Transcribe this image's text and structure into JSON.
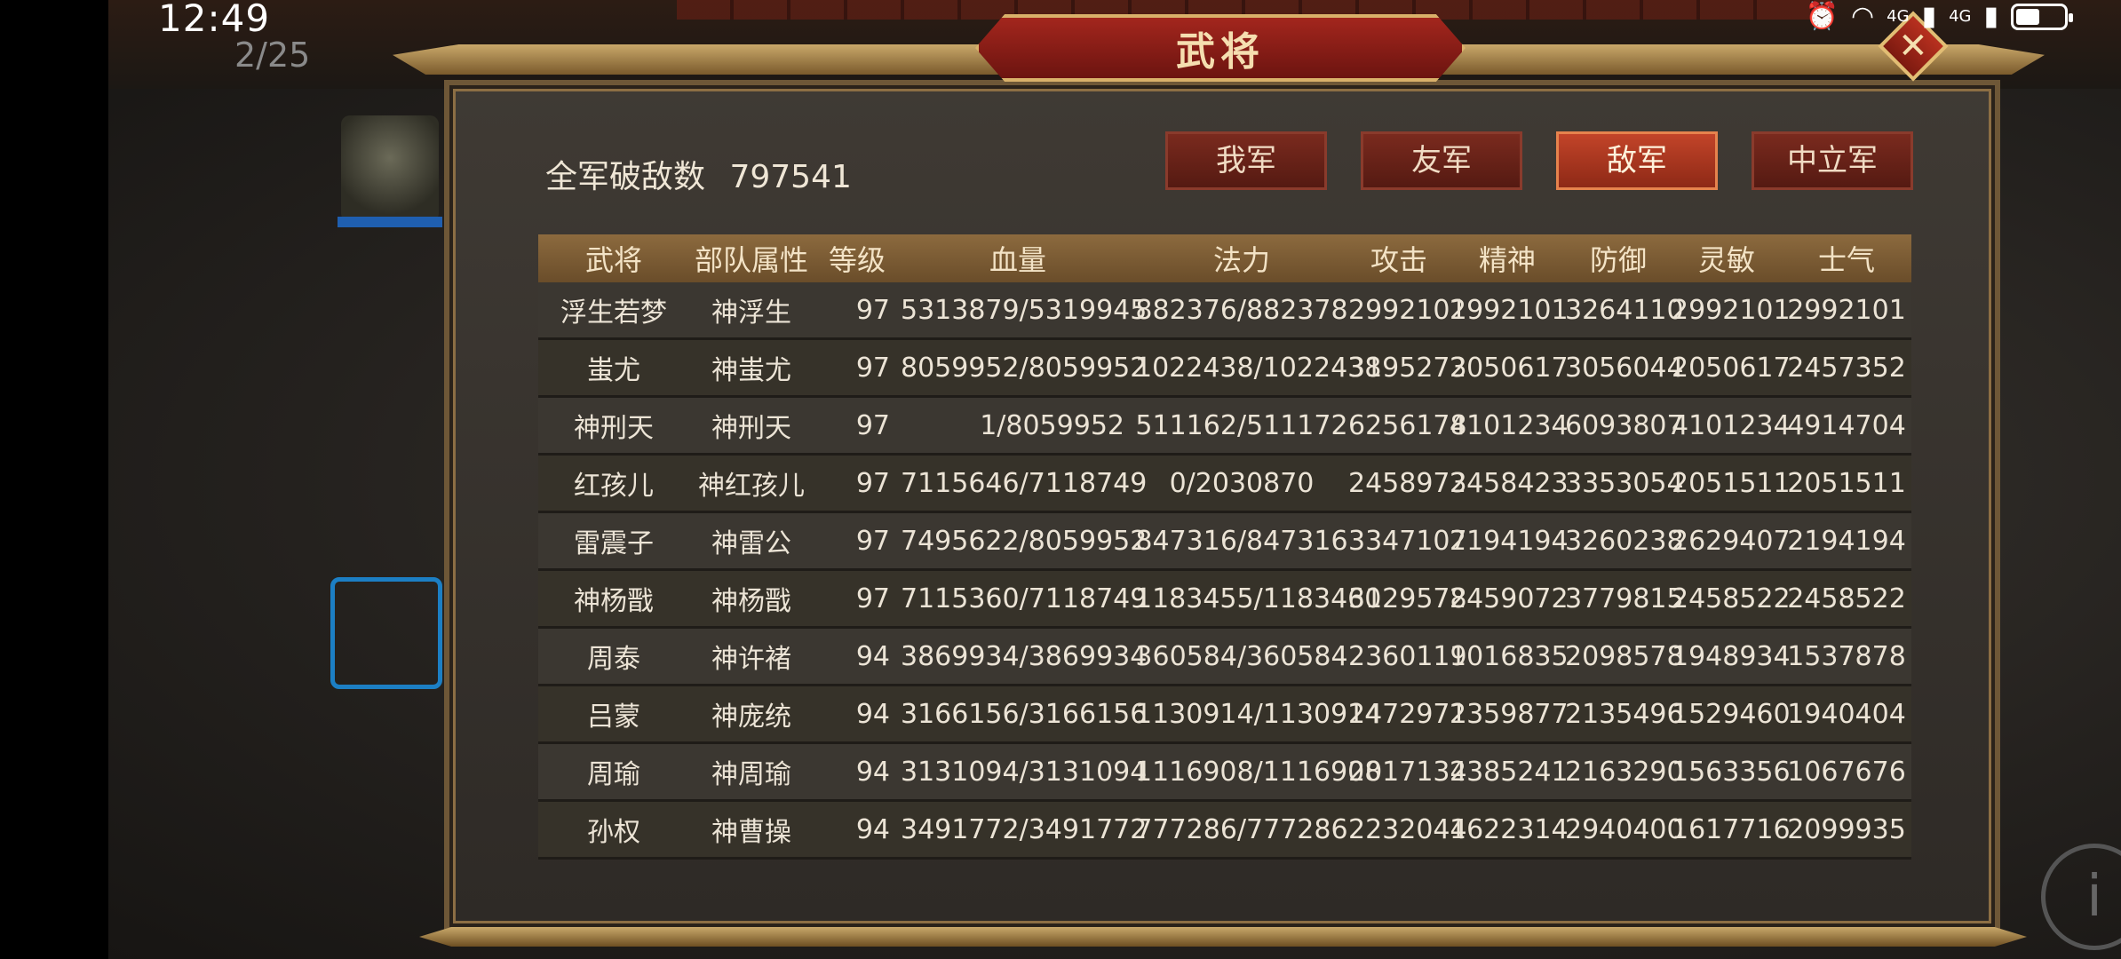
{
  "status_bar": {
    "time": "12:49",
    "icons": [
      "alarm-icon",
      "wifi-icon",
      "signal-4g-icon",
      "signal-4g-icon",
      "battery-icon"
    ],
    "network_label_1": "4G",
    "network_label_2": "4G"
  },
  "hud": {
    "page_counter": "2/25"
  },
  "dialog": {
    "title": "武将",
    "kills_label": "全军破敌数",
    "kills_value": "797541",
    "tabs": [
      {
        "label": "我军",
        "active": false
      },
      {
        "label": "友军",
        "active": false
      },
      {
        "label": "敌军",
        "active": true
      },
      {
        "label": "中立军",
        "active": false
      }
    ],
    "columns": [
      "武将",
      "部队属性",
      "等级",
      "血量",
      "法力",
      "攻击",
      "精神",
      "防御",
      "灵敏",
      "士气"
    ],
    "rows": [
      [
        "浮生若梦",
        "神浮生",
        "97",
        "5313879/5319945",
        "882376/882378",
        "2992101",
        "2992101",
        "3264110",
        "2992101",
        "2992101"
      ],
      [
        "蚩尤",
        "神蚩尤",
        "97",
        "8059952/8059952",
        "1022438/1022438",
        "3195273",
        "2050617",
        "3056044",
        "2050617",
        "2457352"
      ],
      [
        "神刑天",
        "神刑天",
        "97",
        "1/8059952",
        "511162/511172",
        "6256178",
        "4101234",
        "6093807",
        "4101234",
        "4914704"
      ],
      [
        "红孩儿",
        "神红孩儿",
        "97",
        "7115646/7118749",
        "0/2030870",
        "2458973",
        "2458423",
        "3353054",
        "2051511",
        "2051511"
      ],
      [
        "雷震子",
        "神雷公",
        "97",
        "7495622/8059952",
        "847316/847316",
        "3347107",
        "2194194",
        "3260238",
        "2629407",
        "2194194"
      ],
      [
        "神杨戬",
        "神杨戬",
        "97",
        "7115360/7118749",
        "1183455/1183460",
        "3129578",
        "2459072",
        "3779815",
        "2458522",
        "2458522"
      ],
      [
        "周泰",
        "神许褚",
        "94",
        "3869934/3869934",
        "360584/360584",
        "2360119",
        "1016835",
        "2098578",
        "1948934",
        "1537878"
      ],
      [
        "吕蒙",
        "神庞统",
        "94",
        "3166156/3166156",
        "1130914/1130914",
        "2472971",
        "2359877",
        "2135496",
        "1529460",
        "1940404"
      ],
      [
        "周瑜",
        "神周瑜",
        "94",
        "3131094/3131094",
        "1116908/1116908",
        "2017134",
        "2385241",
        "2163290",
        "1563356",
        "1067676"
      ],
      [
        "孙权",
        "神曹操",
        "94",
        "3491772/3491772",
        "777286/777286",
        "2232044",
        "1622314",
        "2940400",
        "1617716",
        "2099935"
      ]
    ]
  },
  "colors": {
    "title_plaque": "#a3261d",
    "active_tab": "#c24429",
    "header_bar": "#8c6a3e",
    "text": "#ece4d6"
  }
}
